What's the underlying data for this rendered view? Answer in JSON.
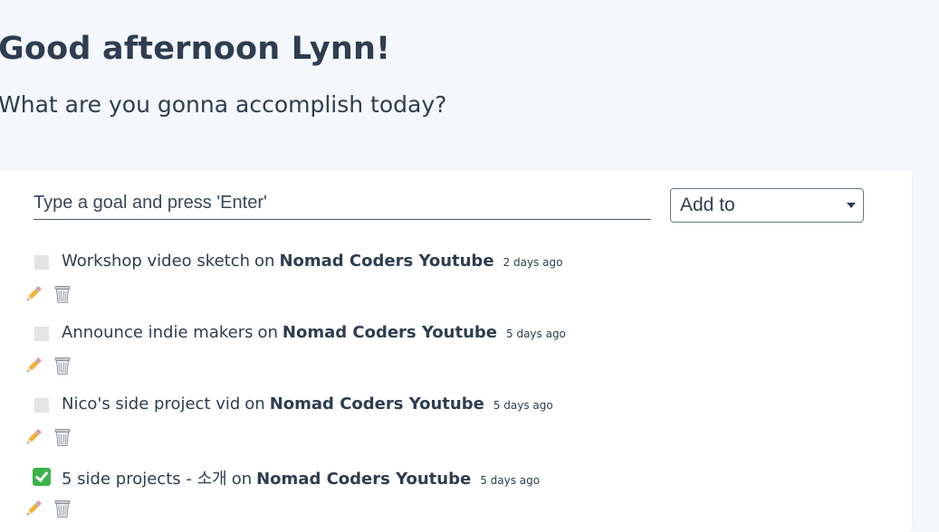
{
  "header": {
    "greeting": "Good afternoon Lynn!",
    "subtitle": "What are you gonna accomplish today?"
  },
  "form": {
    "input_placeholder": "Type a goal and press 'Enter'",
    "input_value": "",
    "select_label": "Add to"
  },
  "todos": [
    {
      "text": "Workshop video sketch",
      "on": "on",
      "project": "Nomad Coders Youtube",
      "time": "2 days ago",
      "done": false
    },
    {
      "text": "Announce indie makers",
      "on": "on",
      "project": "Nomad Coders Youtube",
      "time": "5 days ago",
      "done": false
    },
    {
      "text": "Nico's side project vid",
      "on": "on",
      "project": "Nomad Coders Youtube",
      "time": "5 days ago",
      "done": false
    },
    {
      "text": "5 side projects - 소개",
      "on": "on",
      "project": "Nomad Coders Youtube",
      "time": "5 days ago",
      "done": true
    }
  ],
  "icons": {
    "edit": "pencil-icon",
    "delete": "wastebasket-icon",
    "done": "white-check-mark-icon"
  },
  "colors": {
    "page_bg": "#f4f7fb",
    "card_bg": "#ffffff",
    "text": "#2f3d50",
    "checkbox_unchecked": "#e4e4e4",
    "checkbox_checked": "#3bb34a"
  }
}
